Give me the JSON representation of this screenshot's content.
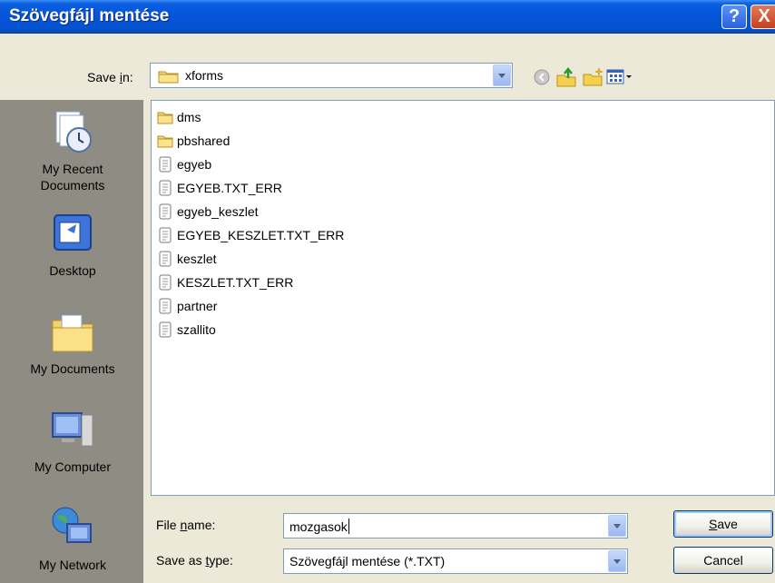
{
  "window": {
    "title": "Szövegfájl mentése",
    "help_glyph": "?",
    "close_glyph": "X"
  },
  "toolbar": {
    "save_in_label_pre": "Save ",
    "save_in_label_accel": "i",
    "save_in_label_post": "n:",
    "save_in_value": "xforms",
    "icons": [
      "back-icon",
      "up-folder-icon",
      "new-folder-icon",
      "view-menu-icon"
    ]
  },
  "places": [
    {
      "label": "My Recent\nDocuments",
      "line1": "My Recent",
      "line2": "Documents",
      "icon": "recent-documents-icon"
    },
    {
      "label": "Desktop",
      "icon": "desktop-icon"
    },
    {
      "label": "My Documents",
      "icon": "my-documents-icon"
    },
    {
      "label": "My Computer",
      "icon": "my-computer-icon"
    },
    {
      "label": "My Network",
      "icon": "my-network-icon"
    }
  ],
  "files": [
    {
      "name": "dms",
      "type": "folder"
    },
    {
      "name": "pbshared",
      "type": "folder"
    },
    {
      "name": "egyeb",
      "type": "text"
    },
    {
      "name": "EGYEB.TXT_ERR",
      "type": "text"
    },
    {
      "name": "egyeb_keszlet",
      "type": "text"
    },
    {
      "name": "EGYEB_KESZLET.TXT_ERR",
      "type": "text"
    },
    {
      "name": "keszlet",
      "type": "text"
    },
    {
      "name": "KESZLET.TXT_ERR",
      "type": "text"
    },
    {
      "name": "partner",
      "type": "text"
    },
    {
      "name": "szallito",
      "type": "text"
    }
  ],
  "form": {
    "file_name_label_pre": "File ",
    "file_name_label_accel": "n",
    "file_name_label_post": "ame:",
    "file_name_value": "mozgasok",
    "save_as_type_label_pre": "Save as ",
    "save_as_type_label_accel": "t",
    "save_as_type_label_post": "ype:",
    "save_as_type_value": "Szövegfájl mentése (*.TXT)"
  },
  "buttons": {
    "save_accel": "S",
    "save_rest": "ave",
    "cancel": "Cancel"
  }
}
